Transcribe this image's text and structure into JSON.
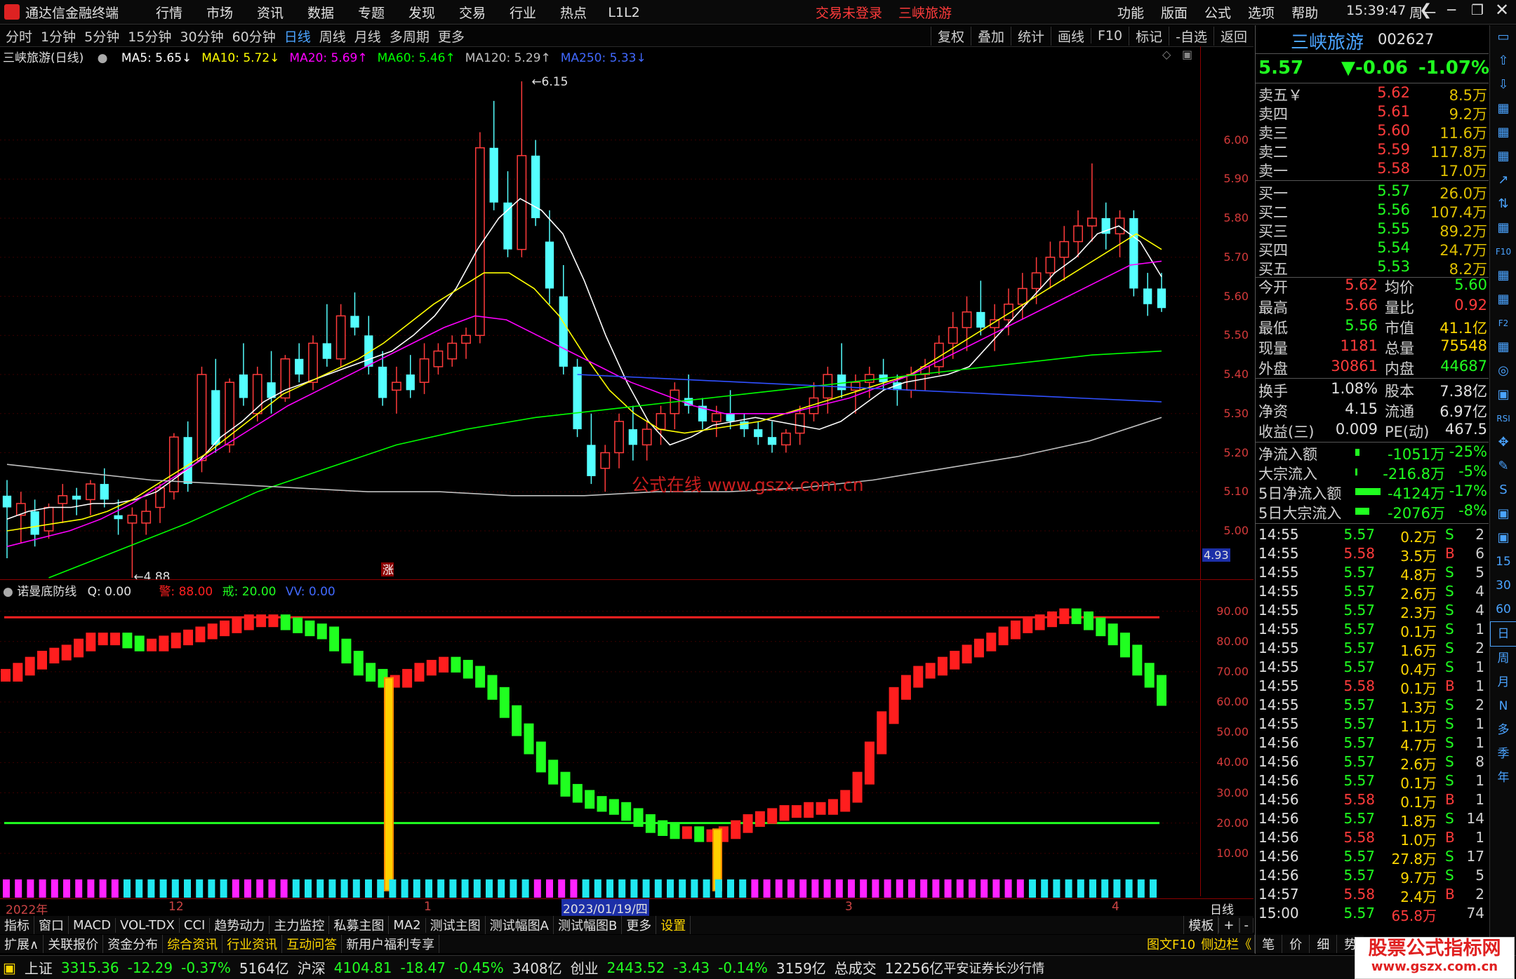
{
  "titlebar": {
    "app_name": "通达信金融终端",
    "menu": [
      "行情",
      "市场",
      "资讯",
      "数据",
      "专题",
      "发现",
      "交易",
      "行业",
      "热点",
      "L1L2"
    ],
    "login_status": "交易未登录",
    "stock_name": "三峡旅游",
    "right_menu": [
      "功能",
      "版面",
      "公式",
      "选项",
      "帮助"
    ],
    "time": "15:39:47",
    "weekday": "周一"
  },
  "toolbar": {
    "periods": [
      "分时",
      "1分钟",
      "5分钟",
      "15分钟",
      "30分钟",
      "60分钟",
      "日线",
      "周线",
      "月线",
      "多周期",
      "更多"
    ],
    "active_period": "日线",
    "tools": [
      "复权",
      "叠加",
      "统计",
      "画线",
      "F10",
      "标记",
      "-自选",
      "返回"
    ]
  },
  "main_chart": {
    "title": "三峡旅游(日线)",
    "ma": [
      {
        "label": "MA5: 5.65",
        "arrow": "↓",
        "color": "#ffffff"
      },
      {
        "label": "MA10: 5.72",
        "arrow": "↓",
        "color": "#ffff00"
      },
      {
        "label": "MA20: 5.69",
        "arrow": "↑",
        "color": "#ff00ff"
      },
      {
        "label": "MA60: 5.46",
        "arrow": "↑",
        "color": "#00ff00"
      },
      {
        "label": "MA120: 5.29",
        "arrow": "↑",
        "color": "#c0c0c0"
      },
      {
        "label": "MA250: 5.33",
        "arrow": "↓",
        "color": "#4169ff"
      }
    ],
    "high_label": "6.15",
    "low_label": "4.88",
    "watermark": "公式在线 www.gszx.com.cn",
    "marker": "涨",
    "price_ticks": [
      "6.00",
      "5.90",
      "5.80",
      "5.70",
      "5.60",
      "5.50",
      "5.40",
      "5.30",
      "5.20",
      "5.10",
      "5.00"
    ],
    "current_axis_label": "4.93"
  },
  "sub_chart": {
    "title": "诺曼底防线",
    "q_label": "Q: 0.00",
    "warn_label": "警: 88.00",
    "jie_label": "戒: 20.00",
    "vv_label": "VV: 0.00",
    "ticks": [
      "90.00",
      "80.00",
      "70.00",
      "60.00",
      "50.00",
      "40.00",
      "30.00",
      "20.00",
      "10.00"
    ]
  },
  "date_bar": {
    "labels": [
      "2022年",
      "12",
      "1",
      "2023/01/19/四",
      "3",
      "4"
    ],
    "period_label": "日线"
  },
  "tabs1": [
    "指标",
    "窗口",
    "MACD",
    "VOL-TDX",
    "CCI",
    "趋势动力",
    "主力监控",
    "私募主图",
    "MA2",
    "测试主图",
    "测试幅图A",
    "测试幅图B",
    "更多",
    "设置"
  ],
  "tabs1_right": [
    "模板",
    "+",
    "-"
  ],
  "tabs2": [
    "扩展∧",
    "关联报价",
    "资金分布",
    "综合资讯",
    "行业资讯",
    "互动问答",
    "新用户福利专享"
  ],
  "tabs2_right": [
    "图文F10",
    "侧边栏《",
    "笔",
    "价",
    "细",
    "势"
  ],
  "right_panel": {
    "name": "三峡旅游",
    "code": "002627",
    "price": "5.57",
    "change": "▼-0.06",
    "pct": "-1.07%",
    "asks": [
      {
        "label": "卖五￥",
        "price": "5.62",
        "vol": "8.5万"
      },
      {
        "label": "卖四",
        "price": "5.61",
        "vol": "9.2万"
      },
      {
        "label": "卖三",
        "price": "5.60",
        "vol": "11.6万"
      },
      {
        "label": "卖二",
        "price": "5.59",
        "vol": "117.8万"
      },
      {
        "label": "卖一",
        "price": "5.58",
        "vol": "17.0万"
      }
    ],
    "bids": [
      {
        "label": "买一",
        "price": "5.57",
        "vol": "26.0万"
      },
      {
        "label": "买二",
        "price": "5.56",
        "vol": "107.4万"
      },
      {
        "label": "买三",
        "price": "5.55",
        "vol": "89.2万"
      },
      {
        "label": "买四",
        "price": "5.54",
        "vol": "24.7万"
      },
      {
        "label": "买五",
        "price": "5.53",
        "vol": "8.2万"
      }
    ],
    "stats": [
      {
        "l1": "今开",
        "v1": "5.62",
        "l2": "均价",
        "v2": "5.60"
      },
      {
        "l1": "最高",
        "v1": "5.66",
        "l2": "量比",
        "v2": "0.92"
      },
      {
        "l1": "最低",
        "v1": "5.56",
        "l2": "市值",
        "v2": "41.1亿"
      },
      {
        "l1": "现量",
        "v1": "1181",
        "l2": "总量",
        "v2": "75548"
      },
      {
        "l1": "外盘",
        "v1": "30861",
        "l2": "内盘",
        "v2": "44687"
      }
    ],
    "stats2": [
      {
        "l1": "换手",
        "v1": "1.08%",
        "l2": "股本",
        "v2": "7.38亿"
      },
      {
        "l1": "净资",
        "v1": "4.15",
        "l2": "流通",
        "v2": "6.97亿"
      },
      {
        "l1": "收益(三)",
        "v1": "0.009",
        "l2": "PE(动)",
        "v2": "467.5"
      }
    ],
    "flows": [
      {
        "label": "净流入额",
        "amt": "-1051万",
        "pct": "-25%"
      },
      {
        "label": "大宗流入",
        "amt": "-216.8万",
        "pct": "-5%"
      },
      {
        "label": "5日净流入额",
        "amt": "-4124万",
        "pct": "-17%"
      },
      {
        "label": "5日大宗流入",
        "amt": "-2076万",
        "pct": "-8%"
      }
    ],
    "ticks": [
      {
        "t": "14:55",
        "p": "5.57",
        "v": "0.2万",
        "s": "S",
        "n": "2"
      },
      {
        "t": "14:55",
        "p": "5.58",
        "v": "3.5万",
        "s": "B",
        "n": "6"
      },
      {
        "t": "14:55",
        "p": "5.57",
        "v": "4.8万",
        "s": "S",
        "n": "5"
      },
      {
        "t": "14:55",
        "p": "5.57",
        "v": "2.6万",
        "s": "S",
        "n": "4"
      },
      {
        "t": "14:55",
        "p": "5.57",
        "v": "2.3万",
        "s": "S",
        "n": "4"
      },
      {
        "t": "14:55",
        "p": "5.57",
        "v": "0.1万",
        "s": "S",
        "n": "1"
      },
      {
        "t": "14:55",
        "p": "5.57",
        "v": "1.6万",
        "s": "S",
        "n": "2"
      },
      {
        "t": "14:55",
        "p": "5.57",
        "v": "0.4万",
        "s": "S",
        "n": "1"
      },
      {
        "t": "14:55",
        "p": "5.58",
        "v": "0.1万",
        "s": "B",
        "n": "1"
      },
      {
        "t": "14:55",
        "p": "5.57",
        "v": "1.3万",
        "s": "S",
        "n": "2"
      },
      {
        "t": "14:55",
        "p": "5.57",
        "v": "1.1万",
        "s": "S",
        "n": "1"
      },
      {
        "t": "14:56",
        "p": "5.57",
        "v": "4.7万",
        "s": "S",
        "n": "1"
      },
      {
        "t": "14:56",
        "p": "5.57",
        "v": "2.6万",
        "s": "S",
        "n": "8"
      },
      {
        "t": "14:56",
        "p": "5.57",
        "v": "0.1万",
        "s": "S",
        "n": "1"
      },
      {
        "t": "14:56",
        "p": "5.58",
        "v": "0.1万",
        "s": "B",
        "n": "1"
      },
      {
        "t": "14:56",
        "p": "5.57",
        "v": "1.8万",
        "s": "S",
        "n": "14"
      },
      {
        "t": "14:56",
        "p": "5.58",
        "v": "1.0万",
        "s": "B",
        "n": "1"
      },
      {
        "t": "14:56",
        "p": "5.57",
        "v": "27.8万",
        "s": "S",
        "n": "17"
      },
      {
        "t": "14:56",
        "p": "5.57",
        "v": "9.7万",
        "s": "S",
        "n": "5"
      },
      {
        "t": "14:57",
        "p": "5.58",
        "v": "2.4万",
        "s": "B",
        "n": "2"
      },
      {
        "t": "15:00",
        "p": "5.57",
        "v": "65.8万",
        "s": "",
        "n": "74"
      }
    ]
  },
  "icon_sidebar": [
    "15",
    "30",
    "60",
    "日",
    "周",
    "月",
    "N",
    "多",
    "季",
    "年"
  ],
  "statusbar": {
    "sh": {
      "name": "上证",
      "val": "3315.36",
      "chg": "-12.29",
      "pct": "-0.37%",
      "amt": "5164亿"
    },
    "hs": {
      "name": "沪深",
      "val": "4104.81",
      "chg": "-18.47",
      "pct": "-0.45%",
      "amt": "3408亿"
    },
    "cy": {
      "name": "创业",
      "val": "2443.52",
      "chg": "-3.43",
      "pct": "-0.14%",
      "amt": "3159亿"
    },
    "total_label": "总成交",
    "total": "12256亿",
    "broker": "平安证券长沙行情",
    "watermark_site": "股票公式指标网",
    "watermark_url": "www.gszx.com.cn"
  },
  "colors": {
    "up": "#ff3b3b",
    "down": "#20ff20",
    "candle_down": "#54ffff",
    "bg": "#000000"
  },
  "chart_data": {
    "type": "candlestick",
    "description_note": "",
    "price_range": [
      4.93,
      6.15
    ],
    "subchart_range": [
      0,
      95
    ],
    "candles": [
      [
        5.09,
        5.13,
        4.93,
        5.06
      ],
      [
        5.04,
        5.1,
        4.97,
        5.07
      ],
      [
        5.05,
        5.08,
        4.96,
        4.99
      ],
      [
        5.0,
        5.07,
        4.98,
        5.06
      ],
      [
        5.07,
        5.12,
        5.02,
        5.09
      ],
      [
        5.09,
        5.11,
        5.04,
        5.08
      ],
      [
        5.08,
        5.13,
        5.04,
        5.12
      ],
      [
        5.12,
        5.16,
        5.06,
        5.08
      ],
      [
        5.04,
        5.08,
        4.99,
        5.03
      ],
      [
        5.02,
        5.06,
        4.88,
        5.04
      ],
      [
        5.02,
        5.08,
        4.99,
        5.05
      ],
      [
        5.06,
        5.12,
        5.02,
        5.11
      ],
      [
        5.1,
        5.25,
        5.08,
        5.24
      ],
      [
        5.24,
        5.28,
        5.1,
        5.12
      ],
      [
        5.18,
        5.42,
        5.15,
        5.4
      ],
      [
        5.36,
        5.44,
        5.2,
        5.22
      ],
      [
        5.22,
        5.39,
        5.2,
        5.38
      ],
      [
        5.4,
        5.48,
        5.32,
        5.34
      ],
      [
        5.3,
        5.42,
        5.28,
        5.4
      ],
      [
        5.38,
        5.46,
        5.3,
        5.34
      ],
      [
        5.34,
        5.45,
        5.33,
        5.44
      ],
      [
        5.44,
        5.48,
        5.38,
        5.4
      ],
      [
        5.38,
        5.5,
        5.36,
        5.48
      ],
      [
        5.48,
        5.58,
        5.42,
        5.44
      ],
      [
        5.44,
        5.58,
        5.42,
        5.55
      ],
      [
        5.55,
        5.61,
        5.5,
        5.52
      ],
      [
        5.5,
        5.55,
        5.4,
        5.42
      ],
      [
        5.42,
        5.46,
        5.32,
        5.34
      ],
      [
        5.36,
        5.42,
        5.3,
        5.38
      ],
      [
        5.4,
        5.45,
        5.34,
        5.36
      ],
      [
        5.38,
        5.48,
        5.35,
        5.44
      ],
      [
        5.42,
        5.48,
        5.4,
        5.46
      ],
      [
        5.44,
        5.5,
        5.42,
        5.48
      ],
      [
        5.48,
        5.52,
        5.44,
        5.5
      ],
      [
        5.5,
        6.02,
        5.48,
        5.98
      ],
      [
        5.98,
        6.1,
        5.82,
        5.84
      ],
      [
        5.84,
        5.92,
        5.7,
        5.72
      ],
      [
        5.72,
        6.15,
        5.7,
        5.96
      ],
      [
        5.96,
        6.0,
        5.78,
        5.8
      ],
      [
        5.74,
        5.82,
        5.58,
        5.62
      ],
      [
        5.6,
        5.68,
        5.4,
        5.42
      ],
      [
        5.42,
        5.44,
        5.24,
        5.26
      ],
      [
        5.22,
        5.3,
        5.12,
        5.14
      ],
      [
        5.16,
        5.22,
        5.1,
        5.2
      ],
      [
        5.2,
        5.3,
        5.16,
        5.28
      ],
      [
        5.26,
        5.32,
        5.18,
        5.22
      ],
      [
        5.22,
        5.28,
        5.18,
        5.26
      ],
      [
        5.26,
        5.32,
        5.22,
        5.3
      ],
      [
        5.3,
        5.38,
        5.26,
        5.36
      ],
      [
        5.34,
        5.4,
        5.3,
        5.32
      ],
      [
        5.32,
        5.34,
        5.26,
        5.28
      ],
      [
        5.28,
        5.32,
        5.24,
        5.3
      ],
      [
        5.3,
        5.36,
        5.26,
        5.28
      ],
      [
        5.28,
        5.3,
        5.24,
        5.26
      ],
      [
        5.26,
        5.28,
        5.22,
        5.24
      ],
      [
        5.24,
        5.28,
        5.2,
        5.22
      ],
      [
        5.22,
        5.26,
        5.2,
        5.25
      ],
      [
        5.25,
        5.32,
        5.22,
        5.3
      ],
      [
        5.3,
        5.38,
        5.28,
        5.34
      ],
      [
        5.34,
        5.42,
        5.3,
        5.4
      ],
      [
        5.4,
        5.48,
        5.34,
        5.36
      ],
      [
        5.36,
        5.4,
        5.3,
        5.38
      ],
      [
        5.38,
        5.42,
        5.34,
        5.4
      ],
      [
        5.4,
        5.44,
        5.36,
        5.38
      ],
      [
        5.38,
        5.4,
        5.32,
        5.36
      ],
      [
        5.36,
        5.42,
        5.34,
        5.4
      ],
      [
        5.4,
        5.44,
        5.36,
        5.42
      ],
      [
        5.42,
        5.5,
        5.4,
        5.48
      ],
      [
        5.48,
        5.56,
        5.44,
        5.52
      ],
      [
        5.52,
        5.6,
        5.46,
        5.56
      ],
      [
        5.56,
        5.64,
        5.5,
        5.52
      ],
      [
        5.52,
        5.58,
        5.46,
        5.54
      ],
      [
        5.54,
        5.62,
        5.5,
        5.58
      ],
      [
        5.58,
        5.66,
        5.54,
        5.62
      ],
      [
        5.62,
        5.7,
        5.58,
        5.66
      ],
      [
        5.66,
        5.74,
        5.62,
        5.7
      ],
      [
        5.7,
        5.78,
        5.64,
        5.74
      ],
      [
        5.74,
        5.82,
        5.7,
        5.78
      ],
      [
        5.78,
        5.94,
        5.74,
        5.8
      ],
      [
        5.8,
        5.84,
        5.72,
        5.76
      ],
      [
        5.76,
        5.82,
        5.7,
        5.8
      ],
      [
        5.8,
        5.82,
        5.6,
        5.62
      ],
      [
        5.62,
        5.66,
        5.55,
        5.58
      ],
      [
        5.62,
        5.66,
        5.56,
        5.57
      ]
    ],
    "ma_series": {
      "MA5": [
        5.03,
        5.05,
        5.06,
        5.06,
        5.07,
        5.07,
        5.08,
        5.1,
        5.14,
        5.18,
        5.24,
        5.28,
        5.33,
        5.36,
        5.38,
        5.4,
        5.42,
        5.44,
        5.46,
        5.5,
        5.55,
        5.62,
        5.72,
        5.8,
        5.85,
        5.82,
        5.76,
        5.64,
        5.5,
        5.38,
        5.28,
        5.22,
        5.24,
        5.27,
        5.28,
        5.29,
        5.28,
        5.27,
        5.26,
        5.28,
        5.32,
        5.36,
        5.38,
        5.39,
        5.4,
        5.42,
        5.48,
        5.54,
        5.6,
        5.66,
        5.7,
        5.76,
        5.78,
        5.74,
        5.65
      ],
      "MA10": [
        5.0,
        5.01,
        5.02,
        5.03,
        5.05,
        5.08,
        5.12,
        5.16,
        5.2,
        5.25,
        5.3,
        5.35,
        5.38,
        5.41,
        5.44,
        5.48,
        5.53,
        5.58,
        5.62,
        5.66,
        5.66,
        5.62,
        5.55,
        5.45,
        5.36,
        5.3,
        5.26,
        5.25,
        5.26,
        5.27,
        5.28,
        5.3,
        5.32,
        5.34,
        5.36,
        5.38,
        5.4,
        5.44,
        5.48,
        5.52,
        5.56,
        5.6,
        5.64,
        5.68,
        5.72,
        5.76,
        5.72
      ],
      "MA20": [
        4.96,
        4.98,
        5.0,
        5.03,
        5.07,
        5.12,
        5.17,
        5.22,
        5.27,
        5.32,
        5.36,
        5.4,
        5.44,
        5.48,
        5.52,
        5.55,
        5.54,
        5.5,
        5.46,
        5.42,
        5.38,
        5.35,
        5.32,
        5.3,
        5.3,
        5.3,
        5.32,
        5.34,
        5.37,
        5.4,
        5.44,
        5.48,
        5.52,
        5.56,
        5.6,
        5.64,
        5.68,
        5.69
      ],
      "MA60": [
        4.88,
        4.95,
        5.02,
        5.1,
        5.16,
        5.22,
        5.26,
        5.29,
        5.31,
        5.33,
        5.35,
        5.37,
        5.39,
        5.41,
        5.43,
        5.45,
        5.46
      ],
      "MA120": [
        5.17,
        5.15,
        5.13,
        5.12,
        5.11,
        5.1,
        5.1,
        5.09,
        5.09,
        5.1,
        5.1,
        5.11,
        5.13,
        5.16,
        5.19,
        5.23,
        5.29
      ],
      "MA250": [
        5.4,
        5.39,
        5.38,
        5.37,
        5.36,
        5.35,
        5.34,
        5.33
      ]
    },
    "norman_values": [
      70,
      72,
      74,
      76,
      77,
      78,
      80,
      82,
      82,
      82,
      81,
      80,
      80,
      81,
      82,
      83,
      84,
      85,
      86,
      87,
      88,
      88,
      88,
      87,
      86,
      85,
      84,
      80,
      76,
      72,
      70,
      68,
      68,
      70,
      72,
      73,
      74,
      73,
      71,
      68,
      64,
      58,
      52,
      46,
      40,
      36,
      32,
      30,
      28,
      27,
      26,
      24,
      22,
      20,
      19,
      18,
      18,
      17,
      17,
      18,
      20,
      22,
      23,
      24,
      25,
      25,
      26,
      26,
      27,
      30,
      36,
      46,
      56,
      64,
      68,
      71,
      72,
      74,
      76,
      78,
      80,
      82,
      84,
      86,
      87,
      88,
      89,
      90,
      89,
      87,
      85,
      82,
      78,
      72,
      68,
      62
    ],
    "signal_bars": [
      32,
      59
    ],
    "levels": {
      "warn": 88,
      "jie": 20
    }
  }
}
